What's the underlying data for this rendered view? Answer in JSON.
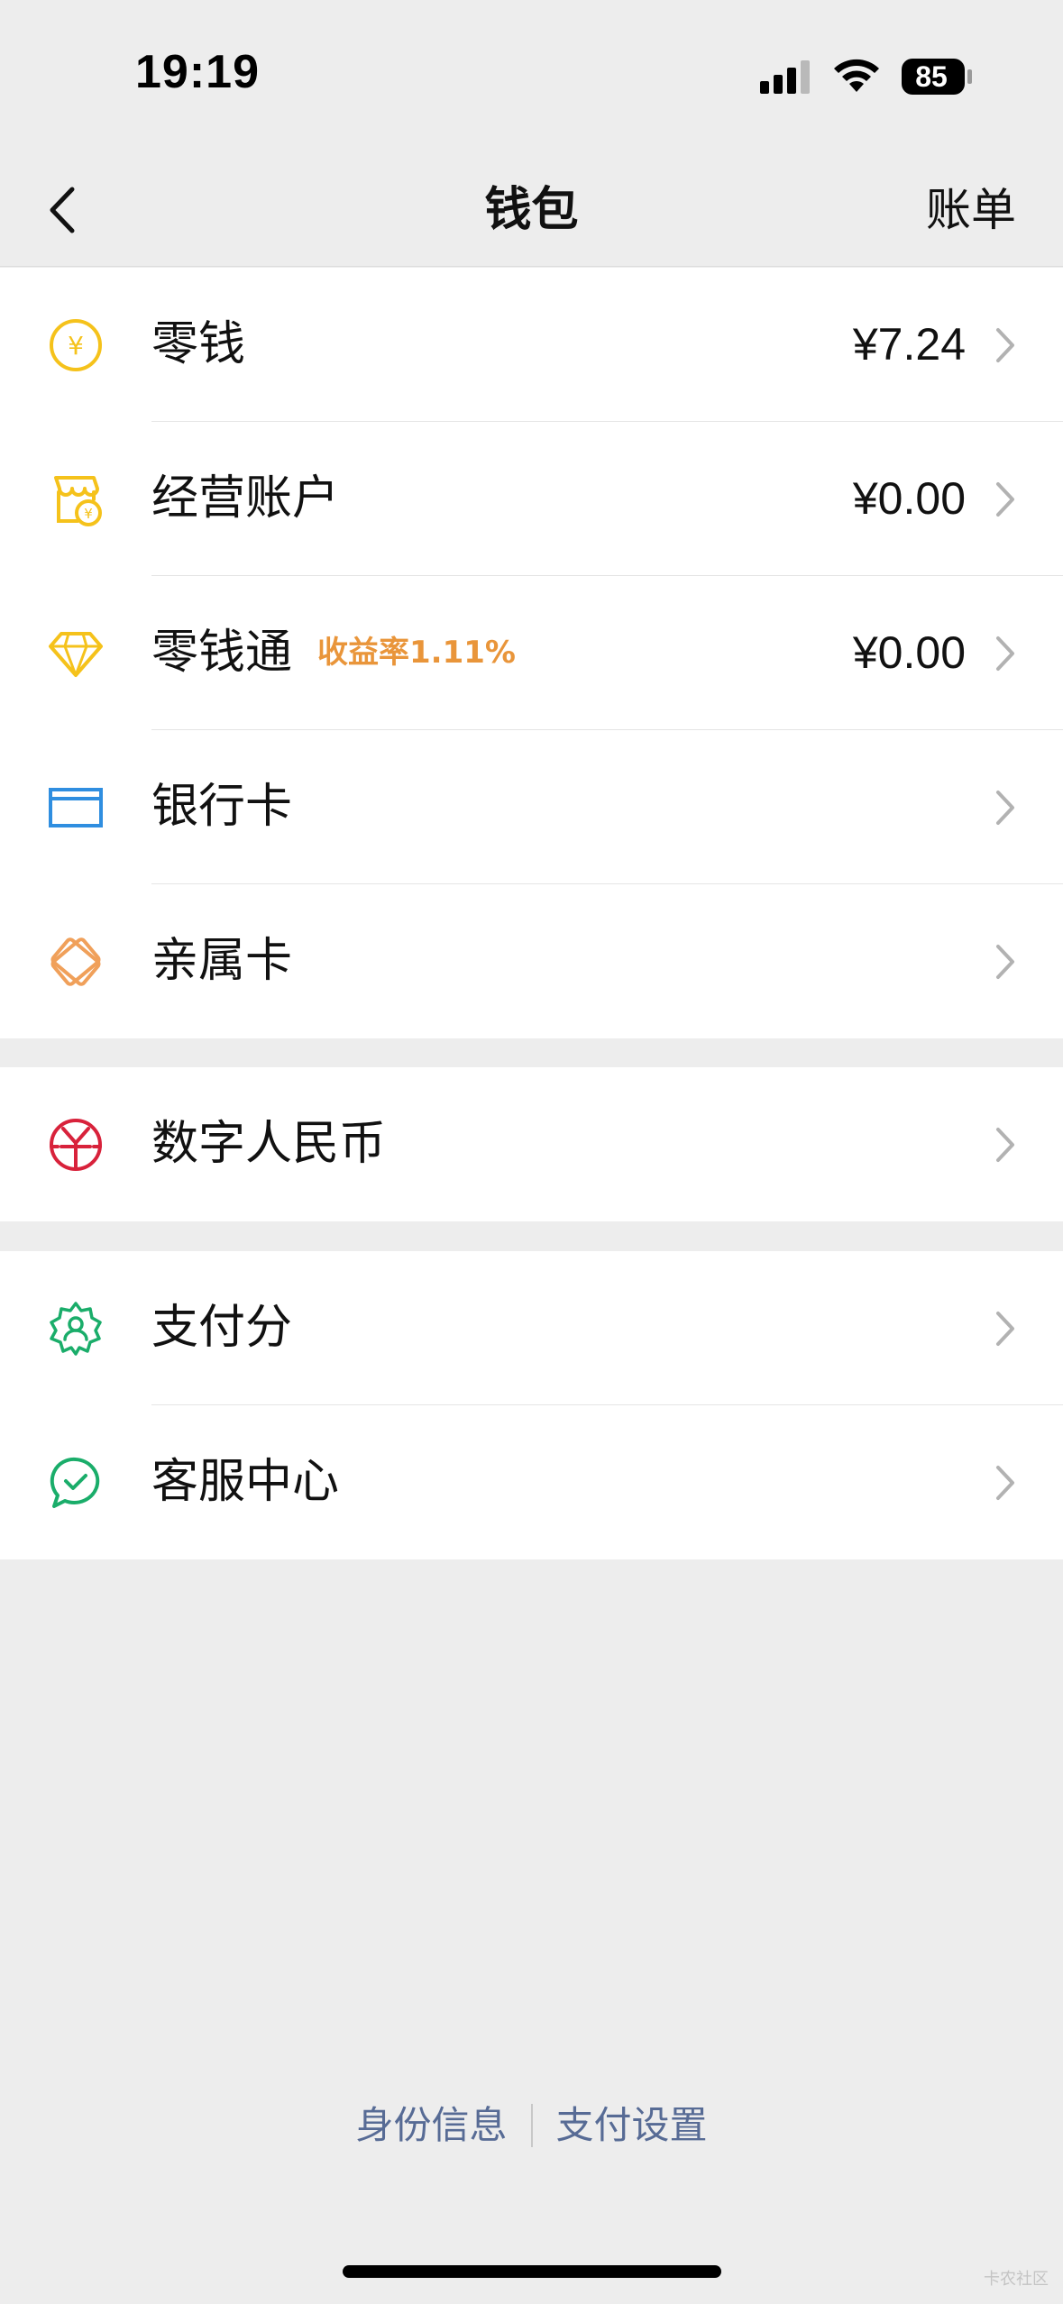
{
  "status": {
    "time": "19:19",
    "battery": "85"
  },
  "nav": {
    "title": "钱包",
    "right_action": "账单"
  },
  "group1": [
    {
      "label": "零钱",
      "amount": "¥7.24",
      "icon": "yuan-coin-icon"
    },
    {
      "label": "经营账户",
      "amount": "¥0.00",
      "icon": "shop-icon"
    },
    {
      "label": "零钱通",
      "badge": "收益率1.11%",
      "amount": "¥0.00",
      "icon": "diamond-icon"
    },
    {
      "label": "银行卡",
      "icon": "bank-card-icon"
    },
    {
      "label": "亲属卡",
      "icon": "family-card-icon"
    }
  ],
  "group2": [
    {
      "label": "数字人民币",
      "icon": "digital-rmb-icon"
    }
  ],
  "group3": [
    {
      "label": "支付分",
      "icon": "pay-score-icon"
    },
    {
      "label": "客服中心",
      "icon": "customer-service-icon"
    }
  ],
  "footer": {
    "left_link": "身份信息",
    "right_link": "支付设置"
  },
  "watermark": "卡农社区",
  "colors": {
    "background": "#ededed",
    "accent_yellow": "#f5c21b",
    "link_blue": "#576b95",
    "rate_orange": "#e9953a",
    "card_blue": "#2f8ee0",
    "family_orange": "#f0a05a",
    "rmb_red": "#d8223b",
    "green": "#1aad6a"
  }
}
